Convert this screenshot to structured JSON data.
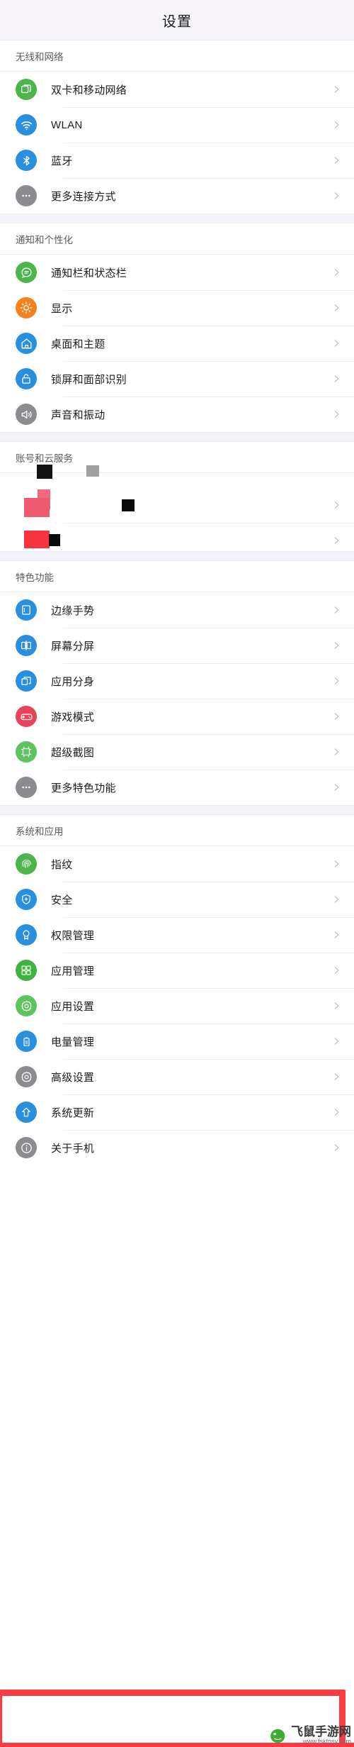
{
  "header": {
    "title": "设置"
  },
  "sections": [
    {
      "id": "wireless",
      "title": "无线和网络",
      "items": [
        {
          "label": "双卡和移动网络",
          "icon": "sim-card-icon",
          "color": "#4cb64c"
        },
        {
          "label": "WLAN",
          "icon": "wifi-icon",
          "color": "#2b8fe0"
        },
        {
          "label": "蓝牙",
          "icon": "bluetooth-icon",
          "color": "#2b8fe0"
        },
        {
          "label": "更多连接方式",
          "icon": "more-dots-icon",
          "color": "#8b8b90"
        }
      ]
    },
    {
      "id": "notification",
      "title": "通知和个性化",
      "items": [
        {
          "label": "通知栏和状态栏",
          "icon": "chat-bubble-icon",
          "color": "#4cb64c"
        },
        {
          "label": "显示",
          "icon": "brightness-sun-icon",
          "color": "#f5811f"
        },
        {
          "label": "桌面和主题",
          "icon": "home-icon",
          "color": "#2b8fe0"
        },
        {
          "label": "锁屏和面部识别",
          "icon": "lock-icon",
          "color": "#2b8fe0"
        },
        {
          "label": "声音和振动",
          "icon": "speaker-icon",
          "color": "#8b8b90"
        }
      ]
    },
    {
      "id": "account",
      "title": "账号和云服务",
      "redacted": true,
      "items": [
        {
          "label": "",
          "icon": "redacted-icon",
          "color": "#ef4b5e"
        },
        {
          "label": "",
          "icon": "redacted-icon",
          "color": "#f5333f"
        }
      ]
    },
    {
      "id": "features",
      "title": "特色功能",
      "items": [
        {
          "label": "边缘手势",
          "icon": "edge-gesture-icon",
          "color": "#2b8fe0"
        },
        {
          "label": "屏幕分屏",
          "icon": "split-screen-icon",
          "color": "#2b8fe0"
        },
        {
          "label": "应用分身",
          "icon": "app-clone-icon",
          "color": "#2b8fe0"
        },
        {
          "label": "游戏模式",
          "icon": "gamepad-icon",
          "color": "#e8435a"
        },
        {
          "label": "超级截图",
          "icon": "screenshot-icon",
          "color": "#5ec45e"
        },
        {
          "label": "更多特色功能",
          "icon": "more-dots-icon",
          "color": "#8b8b90"
        }
      ]
    },
    {
      "id": "system",
      "title": "系统和应用",
      "items": [
        {
          "label": "指纹",
          "icon": "fingerprint-icon",
          "color": "#4cb64c"
        },
        {
          "label": "安全",
          "icon": "shield-icon",
          "color": "#2b8fe0"
        },
        {
          "label": "权限管理",
          "icon": "permission-badge-icon",
          "color": "#2b8fe0"
        },
        {
          "label": "应用管理",
          "icon": "app-manage-icon",
          "color": "#4cb64c"
        },
        {
          "label": "应用设置",
          "icon": "app-settings-gear-icon",
          "color": "#4cb64c"
        },
        {
          "label": "电量管理",
          "icon": "battery-icon",
          "color": "#2b8fe0"
        },
        {
          "label": "高级设置",
          "icon": "advanced-gear-icon",
          "color": "#8b8b90"
        },
        {
          "label": "系统更新",
          "icon": "system-update-arrow-icon",
          "color": "#2b8fe0"
        },
        {
          "label": "关于手机",
          "icon": "info-icon",
          "color": "#8b8b90",
          "highlighted": true
        }
      ]
    }
  ],
  "highlight": {
    "color": "#fb3b44",
    "target": "关于手机"
  },
  "watermark": {
    "name": "飞鼠手游网",
    "url": "www.fsktgsy.com",
    "logo": "mouse-logo-icon"
  }
}
